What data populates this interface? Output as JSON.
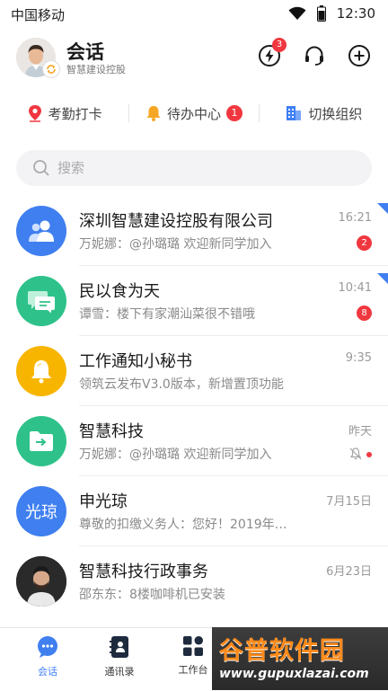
{
  "status_bar": {
    "carrier": "中国移动",
    "time": "12:30"
  },
  "header": {
    "title": "会话",
    "subtitle": "智慧建设控股",
    "notification_count": "3"
  },
  "quick_actions": [
    {
      "label": "考勤打卡",
      "icon": "location-pin-icon"
    },
    {
      "label": "待办中心",
      "icon": "bell-icon",
      "badge": "1"
    },
    {
      "label": "切换组织",
      "icon": "building-icon"
    }
  ],
  "search": {
    "placeholder": "搜索"
  },
  "conversations": [
    {
      "title": "深圳智慧建设控股有限公司",
      "preview": "万妮娜：@孙璐璐 欢迎新同学加入",
      "time": "16:21",
      "unread": "2",
      "pinned": true,
      "avatar": "group-icon",
      "avatar_color": "#3f7ff0"
    },
    {
      "title": "民以食为天",
      "preview": "谭雪：楼下有家潮汕菜很不错哦",
      "time": "10:41",
      "unread": "8",
      "pinned": true,
      "avatar": "chat-bubbles-icon",
      "avatar_color": "#2ec28a"
    },
    {
      "title": "工作通知小秘书",
      "preview": "领筑云发布V3.0版本，新增置顶功能",
      "time": "9:35",
      "avatar": "bell-icon",
      "avatar_color": "#f7b500"
    },
    {
      "title": "智慧科技",
      "preview": "万妮娜：@孙璐璐 欢迎新同学加入",
      "time": "昨天",
      "muted": true,
      "avatar": "folder-share-icon",
      "avatar_color": "#2ec28a"
    },
    {
      "title": "申光琼",
      "preview": "尊敬的扣缴义务人：您好！2019年…",
      "time": "7月15日",
      "avatar_text": "光琼",
      "avatar_color": "#3f7ff0"
    },
    {
      "title": "智慧科技行政事务",
      "preview": "邵东东：8楼咖啡机已安装",
      "time": "6月23日",
      "avatar": "person-photo"
    }
  ],
  "tabs": [
    {
      "label": "会话",
      "icon": "chat-icon",
      "active": true
    },
    {
      "label": "通讯录",
      "icon": "contacts-icon"
    },
    {
      "label": "工作台",
      "icon": "apps-grid-icon"
    }
  ],
  "watermark": {
    "title": "谷普软件园",
    "url": "www.gupuxlazai.com"
  },
  "colors": {
    "accent": "#3f7ff0",
    "badge": "#f0373f",
    "green": "#2ec28a",
    "yellow": "#f7b500"
  }
}
